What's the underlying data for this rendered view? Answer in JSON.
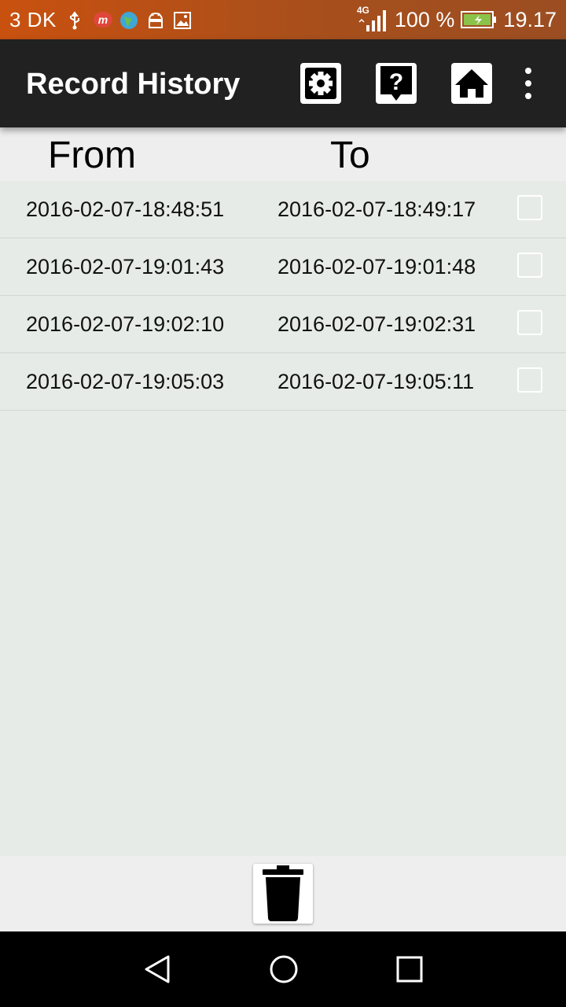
{
  "status_bar": {
    "carrier": "3 DK",
    "network_label": "4G",
    "battery_text": "100 %",
    "time": "19.17",
    "icons": [
      "usb-icon",
      "m-app-icon",
      "globe-icon",
      "android-icon",
      "image-icon",
      "signal-icon",
      "battery-icon"
    ]
  },
  "app_bar": {
    "title": "Record History",
    "actions": [
      "settings-icon",
      "help-icon",
      "home-icon",
      "overflow-menu-icon"
    ]
  },
  "table": {
    "headers": {
      "from": "From",
      "to": "To"
    },
    "rows": [
      {
        "from": "2016-02-07-18:48:51",
        "to": "2016-02-07-18:49:17",
        "checked": false
      },
      {
        "from": "2016-02-07-19:01:43",
        "to": "2016-02-07-19:01:48",
        "checked": false
      },
      {
        "from": "2016-02-07-19:02:10",
        "to": "2016-02-07-19:02:31",
        "checked": false
      },
      {
        "from": "2016-02-07-19:05:03",
        "to": "2016-02-07-19:05:11",
        "checked": false
      }
    ]
  },
  "bottom_bar": {
    "action": "trash-icon"
  },
  "nav_bar": {
    "buttons": [
      "back-icon",
      "home-circle-icon",
      "recents-icon"
    ]
  },
  "colors": {
    "status_bar": "#b4501a",
    "app_bar": "#212121",
    "background": "#e7ebe8",
    "header_background": "#eeeeee",
    "battery_fill": "#8bc34a"
  }
}
